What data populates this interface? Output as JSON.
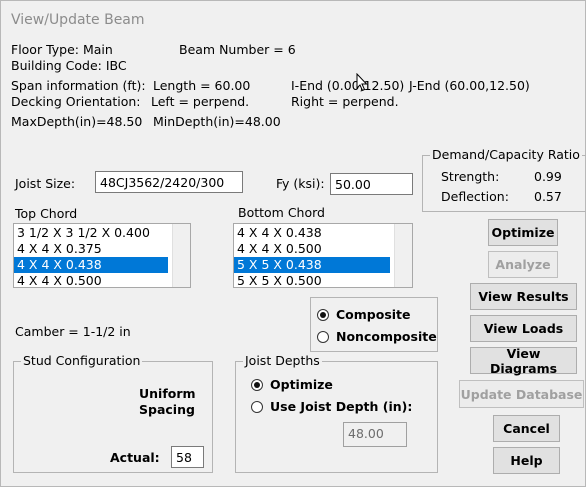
{
  "window": {
    "title": "View/Update Beam"
  },
  "info": {
    "floor_type": "Floor Type: Main",
    "beam_number": "Beam Number = 6",
    "building_code": "Building Code: IBC",
    "span_info": "Span information (ft):",
    "length": "Length = 60.00",
    "i_end": "I-End (0.00,12.50)",
    "j_end": "J-End (60.00,12.50)",
    "decking": "Decking Orientation:",
    "left": "Left = perpend.",
    "right": "Right = perpend.",
    "max_depth": "MaxDepth(in)=48.50",
    "min_depth": "MinDepth(in)=48.00"
  },
  "demand": {
    "title": "Demand/Capacity Ratio",
    "strength_label": "Strength:",
    "strength_value": "0.99",
    "deflection_label": "Deflection:",
    "deflection_value": "0.57"
  },
  "joist": {
    "size_label": "Joist Size:",
    "size_value": "48CJ3562/2420/300",
    "fy_label": "Fy (ksi):",
    "fy_value": "50.00"
  },
  "top_chord": {
    "label": "Top Chord",
    "items": [
      "3 1/2 X 3 1/2 X 0.400",
      "4 X 4 X 0.375",
      "4 X 4 X 0.438",
      "4 X 4 X 0.500"
    ],
    "selected_index": 2
  },
  "bottom_chord": {
    "label": "Bottom Chord",
    "items": [
      "4 X 4 X 0.438",
      "4 X 4 X 0.500",
      "5 X 5 X 0.438",
      "5 X 5 X 0.500"
    ],
    "selected_index": 2
  },
  "composite": {
    "composite_label": "Composite",
    "noncomposite_label": "Noncomposite"
  },
  "camber": "Camber = 1-1/2 in",
  "stud": {
    "title": "Stud Configuration",
    "uniform": "Uniform",
    "spacing": "Spacing",
    "actual_label": "Actual:",
    "actual_value": "58"
  },
  "joist_depths": {
    "title": "Joist Depths",
    "optimize_label": "Optimize",
    "use_depth_label": "Use Joist Depth (in):",
    "depth_value": "48.00"
  },
  "buttons": {
    "optimize": "Optimize",
    "analyze": "Analyze",
    "view_results": "View Results",
    "view_loads": "View Loads",
    "view_diagrams": "View Diagrams",
    "update_database": "Update Database",
    "cancel": "Cancel",
    "help": "Help"
  },
  "colors": {
    "selection": "#0078d7",
    "background": "#f0f0f0"
  }
}
